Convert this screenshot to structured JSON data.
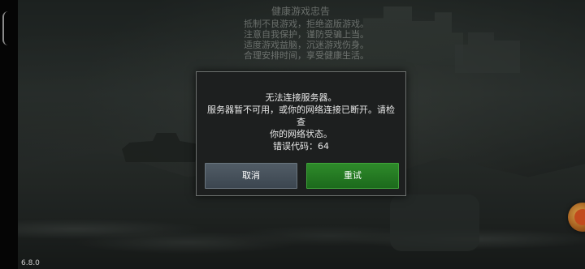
{
  "health_notice": {
    "title": "健康游戏忠告",
    "lines": [
      "抵制不良游戏，拒绝盗版游戏。",
      "注意自我保护，谨防受骗上当。",
      "适度游戏益脑，沉迷游戏伤身。",
      "合理安排时间，享受健康生活。"
    ]
  },
  "dialog": {
    "line1": "无法连接服务器。",
    "line2": "服务器暂不可用，或你的网络连接已断开。请检查",
    "line3": "你的网络状态。",
    "line4": "错误代码：64",
    "cancel_label": "取消",
    "retry_label": "重试"
  },
  "version": "6.8.0",
  "colors": {
    "retry_button": "#2e8a2a",
    "cancel_button": "#515c66",
    "dialog_bg": "#1d1f1f"
  }
}
